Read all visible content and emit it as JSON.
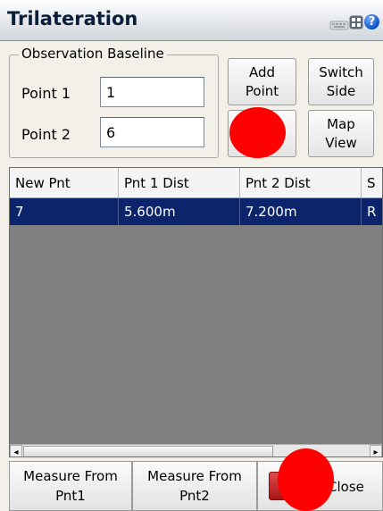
{
  "window": {
    "title": "Trilateration",
    "icons": [
      "keyboard-icon",
      "grid-icon",
      "help-icon"
    ],
    "help_glyph": "?"
  },
  "baseline": {
    "legend": "Observation Baseline",
    "point1_label": "Point 1",
    "point1_value": "1",
    "point2_label": "Point 2",
    "point2_value": "6"
  },
  "buttons": {
    "add_point": "Add\nPoint",
    "switch_side": "Switch\nSide",
    "map_view": "Map\nView",
    "blank": ""
  },
  "table": {
    "columns": [
      "New Pnt",
      "Pnt 1 Dist",
      "Pnt 2 Dist",
      "S"
    ],
    "rows": [
      [
        "7",
        "5.600m",
        "7.200m",
        "R"
      ]
    ],
    "selected_row": 0
  },
  "bottom": {
    "measure_pnt1": "Measure From\nPnt1",
    "measure_pnt2": "Measure From\nPnt2",
    "close": "Close"
  },
  "colors": {
    "selection": "#0b246b",
    "grid_bg": "#808080",
    "marker": "#ff0000"
  }
}
